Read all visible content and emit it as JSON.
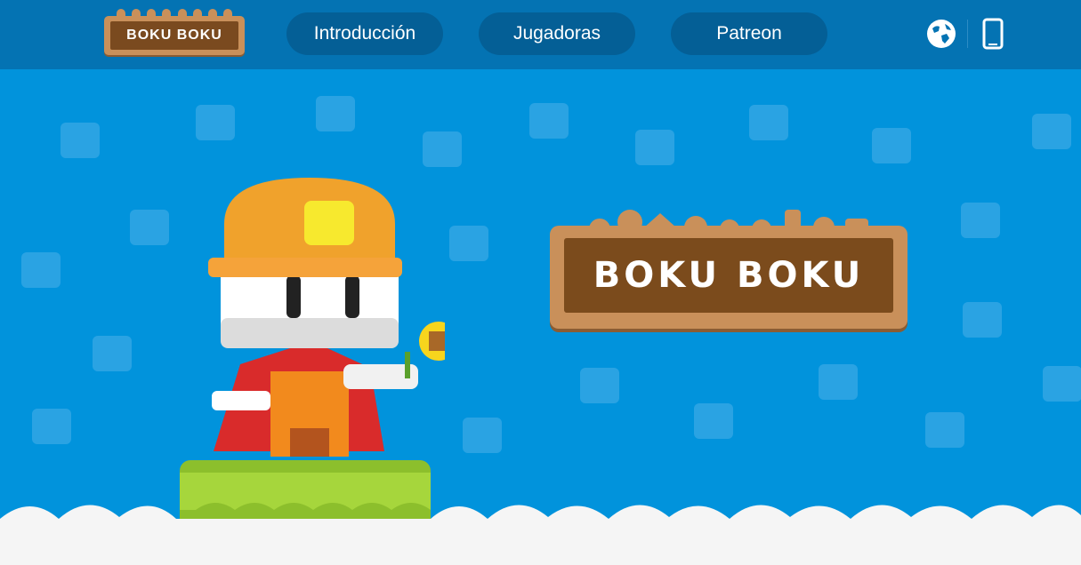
{
  "header": {
    "logo_text": "BOKU BOKU",
    "nav": [
      {
        "label": "Introducción"
      },
      {
        "label": "Jugadoras"
      },
      {
        "label": "Patreon"
      }
    ],
    "icons": [
      "globe-icon",
      "mobile-phone-icon"
    ]
  },
  "hero": {
    "logo_text": "BOKU BOKU",
    "character": "miner-character",
    "colors": {
      "sky": "#0193dc",
      "header": "#0473b3",
      "nav_button": "#045f96",
      "logo_wood": "#7b4b1c"
    }
  }
}
